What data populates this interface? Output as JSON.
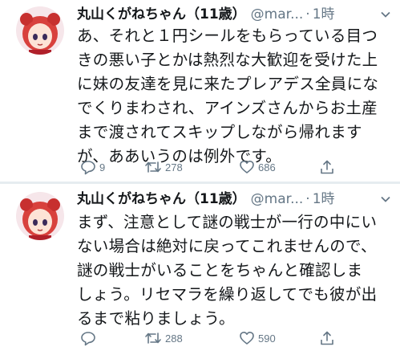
{
  "colors": {
    "text": "#14171a",
    "secondary": "#657786",
    "divider": "#e6ecf0"
  },
  "tweets": [
    {
      "name": "丸山くがねちゃん（11歳）",
      "handle": "@mar...",
      "dot": "·",
      "time": "1時",
      "lines": [
        "あ、それと１円シールをもらっている目つ",
        "きの悪い子とかは熱烈な大歓迎を受けた上",
        "に妹の友達を見に来たプレアデス全員にな",
        "でくりまわされ、アインズさんからお土産",
        "まで渡されてスキップしながら帰れます",
        "が、ああいうのは例外です。"
      ],
      "replies": "9",
      "retweets": "278",
      "likes": "686"
    },
    {
      "name": "丸山くがねちゃん（11歳）",
      "handle": "@mar...",
      "dot": "·",
      "time": "1時",
      "lines": [
        "まず、注意として謎の戦士が一行の中にい",
        "ない場合は絶対に戻ってこれませんので、",
        "謎の戦士がいることをちゃんと確認しま",
        "しょう。リセマラを繰り返してでも彼が出",
        "るまで粘りましょう。"
      ],
      "replies": "",
      "retweets": "288",
      "likes": "590"
    }
  ]
}
